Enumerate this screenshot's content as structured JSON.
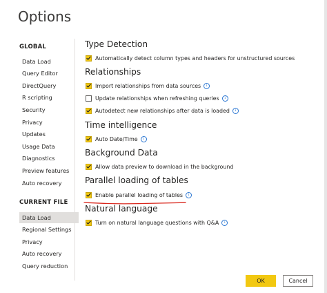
{
  "window": {
    "title": "Options"
  },
  "sidebar": {
    "global_label": "GLOBAL",
    "global_items": [
      "Data Load",
      "Query Editor",
      "DirectQuery",
      "R scripting",
      "Security",
      "Privacy",
      "Updates",
      "Usage Data",
      "Diagnostics",
      "Preview features",
      "Auto recovery"
    ],
    "current_label": "CURRENT FILE",
    "current_items": [
      "Data Load",
      "Regional Settings",
      "Privacy",
      "Auto recovery",
      "Query reduction"
    ],
    "selected": "current_items.0"
  },
  "sections": {
    "type_detection": {
      "heading": "Type Detection",
      "opt1": {
        "label": "Automatically detect column types and headers for unstructured sources",
        "checked": true
      }
    },
    "relationships": {
      "heading": "Relationships",
      "opt1": {
        "label": "Import relationships from data sources",
        "checked": true
      },
      "opt2": {
        "label": "Update relationships when refreshing queries",
        "checked": false
      },
      "opt3": {
        "label": "Autodetect new relationships after data is loaded",
        "checked": true
      }
    },
    "time_intelligence": {
      "heading": "Time intelligence",
      "opt1": {
        "label": "Auto Date/Time",
        "checked": true
      }
    },
    "background_data": {
      "heading": "Background Data",
      "opt1": {
        "label": "Allow data preview to download in the background",
        "checked": true
      }
    },
    "parallel_loading": {
      "heading": "Parallel loading of tables",
      "opt1": {
        "label": "Enable parallel loading of tables",
        "checked": true
      }
    },
    "natural_language": {
      "heading": "Natural language",
      "opt1": {
        "label": "Turn on natural language questions with Q&A",
        "checked": true
      }
    }
  },
  "icons": {
    "info": "info-icon",
    "check": "checkmark-icon"
  },
  "colors": {
    "checkbox_on": "#f2c811",
    "ok_button": "#f2c811",
    "info": "#2a76d2",
    "annotation": "#d9261c"
  },
  "buttons": {
    "ok": "OK",
    "cancel": "Cancel"
  }
}
